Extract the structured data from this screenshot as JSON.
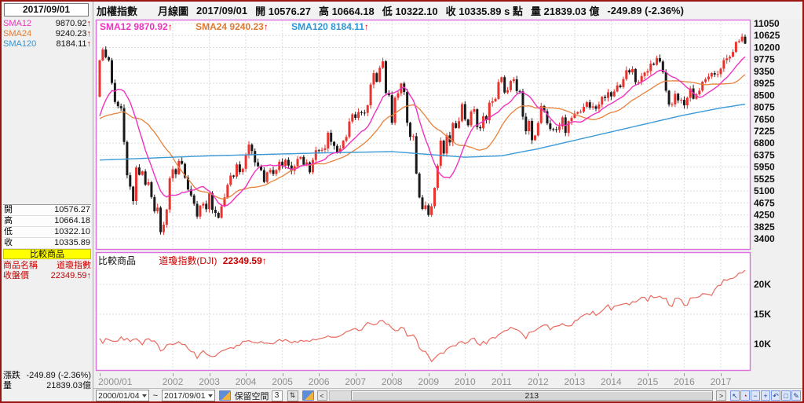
{
  "sidebar": {
    "date": "2017/09/01",
    "sma_rows": [
      {
        "label": "SMA12",
        "value": "9870.92",
        "arrow": "↑",
        "color": "#f032c0"
      },
      {
        "label": "SMA24",
        "value": "9240.23",
        "arrow": "↑",
        "color": "#e07a33"
      },
      {
        "label": "SMA120",
        "value": "8184.11",
        "arrow": "↑",
        "color": "#2f96d6"
      }
    ],
    "ohlc_rows": [
      {
        "label": "開",
        "value": "10576.27"
      },
      {
        "label": "高",
        "value": "10664.18"
      },
      {
        "label": "低",
        "value": "10322.10"
      },
      {
        "label": "收",
        "value": "10335.89"
      }
    ],
    "compare_header": "比較商品",
    "compare_rows": [
      {
        "label": "商品名稱",
        "value": "道瓊指數",
        "arrow": ""
      },
      {
        "label": "收盤價",
        "value": "22349.59",
        "arrow": "↑"
      }
    ],
    "change_rows": [
      {
        "label": "漲跌",
        "value": "-249.89 (-2.36%)"
      },
      {
        "label": "量",
        "value": "21839.03億"
      }
    ]
  },
  "header": {
    "segments": [
      "加權指數",
      "月線圖",
      "2017/09/01",
      "開 10576.27",
      "高 10664.18",
      "低 10322.10",
      "收 10335.89 s 點",
      "量 21839.03 億",
      "-249.89 (-2.36%)"
    ]
  },
  "main_legend": [
    {
      "text": "SMA12 9870.92",
      "arrow": "↑"
    },
    {
      "text": "SMA24 9240.23",
      "arrow": "↑"
    },
    {
      "text": "SMA120 8184.11",
      "arrow": "↑"
    }
  ],
  "compare_legend": {
    "title": "比較商品",
    "name": "道瓊指數(DJI)",
    "value": "22349.59",
    "arrow": "↑"
  },
  "bottombar": {
    "from_date": "2000/01/04",
    "tilde": "~",
    "to_date": "2017/09/01",
    "keep_label": "保留空間",
    "keep_value": "3",
    "spinner_glyph": "⇅",
    "left_arrow": "<",
    "scroll_count": "213",
    "right_arrow": ">",
    "tool_icons": [
      {
        "name": "cursor-icon",
        "glyph": "↖"
      },
      {
        "name": "clock-icon",
        "glyph": "◔"
      },
      {
        "name": "minus-icon",
        "glyph": "−"
      },
      {
        "name": "plus-icon",
        "glyph": "+"
      },
      {
        "name": "undo-icon",
        "glyph": "↶"
      },
      {
        "name": "marquee-icon",
        "glyph": "□"
      },
      {
        "name": "pencil-icon",
        "glyph": "✎"
      }
    ]
  },
  "chart_data": [
    {
      "type": "candlestick",
      "title": "加權指數 月線圖",
      "x_start": "2000/01",
      "x_end": "2017/09",
      "bars": 213,
      "first_open": 8449,
      "pre2000_closes": [
        7915,
        8858,
        8849,
        8979,
        8376,
        7548,
        7761,
        7069,
        6833,
        7093,
        7177,
        6418,
        5998,
        6318,
        6881,
        7371,
        7316,
        8467,
        7327,
        8157,
        7598,
        7854,
        7720,
        8449
      ],
      "closes_by_year": {
        "2000": [
          9744,
          10128,
          9854,
          9747,
          8940,
          8265,
          8115,
          8043,
          6841,
          5659,
          5256,
          4739
        ],
        "2001": [
          5936,
          5674,
          5797,
          5323,
          5410,
          4883,
          4380,
          4509,
          3636,
          3903,
          4441,
          5551
        ],
        "2002": [
          5872,
          5696,
          6167,
          6065,
          5575,
          5153,
          4941,
          4644,
          4191,
          4579,
          4646,
          4452
        ],
        "2003": [
          5015,
          4432,
          4321,
          4148,
          4555,
          4872,
          5318,
          5650,
          5611,
          6045,
          5772,
          5890
        ],
        "2004": [
          6375,
          6750,
          6522,
          6117,
          5977,
          5839,
          5420,
          5765,
          5845,
          5705,
          5844,
          6139
        ],
        "2005": [
          5994,
          6207,
          6005,
          5818,
          5982,
          6241,
          6312,
          6033,
          6118,
          5764,
          6203,
          6548
        ],
        "2006": [
          6532,
          6561,
          6614,
          7171,
          6847,
          6704,
          6454,
          6611,
          6883,
          7021,
          7568,
          7824
        ],
        "2007": [
          7699,
          7901,
          7884,
          7875,
          8145,
          8883,
          9287,
          8982,
          9476,
          9711,
          8586,
          8506
        ],
        "2008": [
          7521,
          8413,
          8572,
          8920,
          8619,
          7524,
          7024,
          7046,
          5719,
          4871,
          4460,
          4591
        ],
        "2009": [
          4248,
          4557,
          5210,
          5993,
          6890,
          6432,
          7077,
          6826,
          7509,
          7340,
          7583,
          8188
        ],
        "2010": [
          7640,
          7436,
          7920,
          8004,
          7374,
          7329,
          7760,
          7616,
          8237,
          8287,
          8372,
          8973
        ],
        "2011": [
          9145,
          8599,
          8683,
          9008,
          9068,
          8653,
          8644,
          7741,
          7225,
          7588,
          6904,
          7072
        ],
        "2012": [
          7517,
          8121,
          7933,
          7501,
          7301,
          7296,
          7270,
          7397,
          7715,
          7166,
          7580,
          7699
        ],
        "2013": [
          7850,
          7898,
          7919,
          8093,
          8254,
          8062,
          8107,
          8021,
          8173,
          8450,
          8406,
          8611
        ],
        "2014": [
          8462,
          8639,
          8849,
          8791,
          9075,
          9393,
          9315,
          9436,
          8966,
          8974,
          9187,
          9307
        ],
        "2015": [
          9361,
          9622,
          9586,
          9820,
          9701,
          9323,
          8665,
          8174,
          8181,
          8554,
          8320,
          8338
        ],
        "2016": [
          8145,
          8411,
          8744,
          8377,
          8535,
          8666,
          8984,
          9068,
          9166,
          9290,
          9240,
          9253
        ],
        "2017": [
          9447,
          9750,
          9811,
          9872,
          10040,
          10395,
          10427,
          10585,
          10335.89
        ]
      },
      "last_candle": {
        "open": 10576.27,
        "high": 10664.18,
        "low": 10322.1,
        "close": 10335.89
      },
      "sma_values": {
        "SMA12": 9870.92,
        "SMA24": 9240.23,
        "SMA120": 8184.11
      },
      "sma120_anchors": [
        [
          0,
          6200
        ],
        [
          36,
          6350
        ],
        [
          72,
          6450
        ],
        [
          96,
          6500
        ],
        [
          120,
          6300
        ],
        [
          132,
          6350
        ],
        [
          144,
          6600
        ],
        [
          156,
          6900
        ],
        [
          168,
          7200
        ],
        [
          180,
          7500
        ],
        [
          192,
          7800
        ],
        [
          204,
          8050
        ],
        [
          212,
          8184.11
        ]
      ],
      "y_ticks": [
        11050,
        10625,
        10200,
        9775,
        9350,
        8925,
        8500,
        8075,
        7650,
        7225,
        6800,
        6375,
        5950,
        5525,
        5100,
        4675,
        4250,
        3825,
        3400
      ],
      "x_labels": [
        {
          "text": "2000/01",
          "i": 0,
          "align": "start"
        },
        {
          "text": "2002",
          "i": 24
        },
        {
          "text": "2003",
          "i": 36
        },
        {
          "text": "2004",
          "i": 48
        },
        {
          "text": "2005",
          "i": 60
        },
        {
          "text": "2006",
          "i": 72
        },
        {
          "text": "2007",
          "i": 84
        },
        {
          "text": "2008",
          "i": 96
        },
        {
          "text": "2009",
          "i": 108
        },
        {
          "text": "2010",
          "i": 120
        },
        {
          "text": "2011",
          "i": 132
        },
        {
          "text": "2012",
          "i": 144
        },
        {
          "text": "2013",
          "i": 156
        },
        {
          "text": "2014",
          "i": 168
        },
        {
          "text": "2015",
          "i": 180
        },
        {
          "text": "2016",
          "i": 192
        },
        {
          "text": "2017",
          "i": 204
        }
      ],
      "colors": {
        "up": "#e8332e",
        "down": "#1a1a1a",
        "sma12": "#f032c0",
        "sma24": "#e8823c",
        "sma120": "#3b9ad8",
        "border": "#de6ede",
        "grid": "#dcdcdc"
      }
    },
    {
      "type": "line",
      "title": "比較商品",
      "name": "道瓊指數(DJI)",
      "last": 22349.59,
      "ylim": [
        5000,
        25000
      ],
      "y_ticks": [
        {
          "text": "20K",
          "v": 20000
        },
        {
          "text": "15K",
          "v": 15000
        },
        {
          "text": "10K",
          "v": 10000
        }
      ],
      "closes_by_year": {
        "2000": [
          10940,
          10128,
          10922,
          10734,
          10522,
          10448,
          10522,
          11215,
          10651,
          10971,
          10414,
          10788
        ],
        "2001": [
          10887,
          10495,
          9879,
          10735,
          10912,
          10502,
          10523,
          9950,
          8848,
          9075,
          9852,
          10022
        ],
        "2002": [
          9920,
          10106,
          10404,
          9946,
          9925,
          9243,
          8737,
          8664,
          7592,
          8397,
          8896,
          8342
        ],
        "2003": [
          8054,
          7891,
          7992,
          8480,
          8850,
          8985,
          9234,
          9416,
          9275,
          9801,
          9782,
          10454
        ],
        "2004": [
          10488,
          10584,
          10358,
          10226,
          10188,
          10435,
          10140,
          10174,
          10080,
          10027,
          10428,
          10783
        ],
        "2005": [
          10490,
          10766,
          10504,
          10193,
          10467,
          10275,
          10641,
          10482,
          10569,
          10440,
          10806,
          10718
        ],
        "2006": [
          10865,
          10993,
          11109,
          11367,
          11168,
          11150,
          11186,
          11381,
          11679,
          12080,
          12222,
          12463
        ],
        "2007": [
          12622,
          12269,
          12354,
          13063,
          13628,
          13409,
          13212,
          13358,
          13896,
          13930,
          13372,
          13265
        ],
        "2008": [
          12650,
          12266,
          12263,
          12820,
          12638,
          11350,
          11378,
          11544,
          10851,
          9325,
          8829,
          8776
        ],
        "2009": [
          8001,
          7063,
          7609,
          8168,
          8500,
          8447,
          9172,
          9496,
          9712,
          9713,
          10345,
          10428
        ],
        "2010": [
          10067,
          10325,
          10857,
          11009,
          10137,
          9774,
          10466,
          10015,
          10788,
          11118,
          11006,
          11578
        ],
        "2011": [
          11892,
          12226,
          12320,
          12811,
          12570,
          12414,
          12143,
          11614,
          10913,
          11955,
          12046,
          12218
        ],
        "2012": [
          12633,
          12952,
          13212,
          13214,
          12393,
          12880,
          13009,
          13091,
          13437,
          13096,
          13026,
          13104
        ],
        "2013": [
          13861,
          14054,
          14579,
          14840,
          15116,
          14910,
          15500,
          14810,
          15130,
          15546,
          16086,
          16577
        ],
        "2014": [
          15699,
          16322,
          16458,
          16581,
          16717,
          16827,
          16563,
          17098,
          17043,
          17391,
          17828,
          17823
        ],
        "2015": [
          17165,
          18133,
          17776,
          17841,
          18011,
          17620,
          17690,
          16528,
          16285,
          17664,
          17720,
          17425
        ],
        "2016": [
          16466,
          16517,
          17685,
          17774,
          17787,
          17930,
          18432,
          18401,
          18308,
          18142,
          19124,
          19763
        ],
        "2017": [
          19864,
          20812,
          20663,
          20941,
          21009,
          21350,
          21891,
          21948,
          22349.59
        ]
      },
      "colors": {
        "line": "#e96a5f",
        "border": "#de6ede",
        "grid": "#dcdcdc"
      }
    }
  ]
}
